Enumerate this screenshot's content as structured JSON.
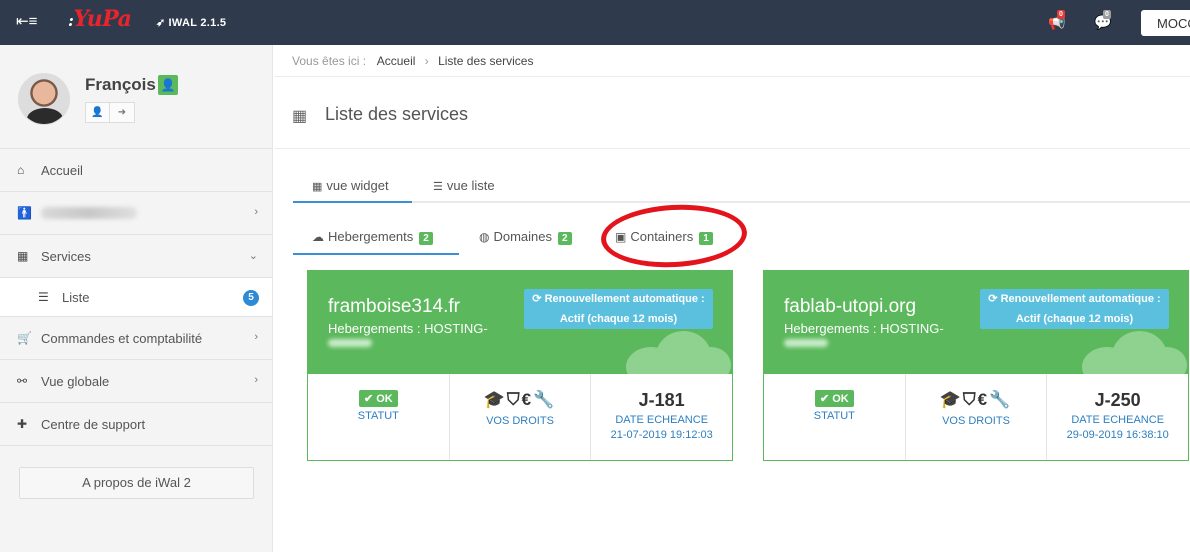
{
  "topbar": {
    "menu_icon": "≡",
    "logo_prefix": ":",
    "logo_text": "YuPa",
    "version": "IWAL 2.1.5",
    "notifications_count": "0",
    "messages_count": "0",
    "user_button": "MOCC"
  },
  "profile": {
    "name": "François"
  },
  "sidebar": {
    "items": [
      {
        "label": "Accueil",
        "icon": "home-icon"
      },
      {
        "label": "",
        "icon": "male-icon"
      },
      {
        "label": "Services",
        "icon": "cubes-icon"
      },
      {
        "label": "Commandes et comptabilité",
        "icon": "cart-icon"
      },
      {
        "label": "Vue globale",
        "icon": "binoculars-icon"
      },
      {
        "label": "Centre de support",
        "icon": "medkit-icon"
      }
    ],
    "sub_item": {
      "label": "Liste",
      "count": "5"
    },
    "about_label": "A propos de iWal 2"
  },
  "breadcrumb": {
    "prefix": "Vous êtes ici :",
    "home": "Accueil",
    "current": "Liste des services"
  },
  "page": {
    "title": "Liste des services"
  },
  "view_tabs": {
    "widget": "vue widget",
    "list": "vue liste"
  },
  "service_tabs": [
    {
      "label": "Hebergements",
      "count": "2"
    },
    {
      "label": "Domaines",
      "count": "2"
    },
    {
      "label": "Containers",
      "count": "1"
    }
  ],
  "cards": [
    {
      "name": "framboise314.fr",
      "plan": "Hebergements : HOSTING-",
      "renew_line1": "Renouvellement automatique :",
      "renew_line2": "Actif (chaque 12 mois)",
      "status": "OK",
      "status_caption": "STATUT",
      "rights_icons": "🎓⛉€🔧",
      "rights_caption": "VOS DROITS",
      "days": "J-181",
      "due_caption": "DATE ECHEANCE",
      "due_date": "21-07-2019 19:12:03"
    },
    {
      "name": "fablab-utopi.org",
      "plan": "Hebergements : HOSTING-",
      "renew_line1": "Renouvellement automatique :",
      "renew_line2": "Actif (chaque 12 mois)",
      "status": "OK",
      "status_caption": "STATUT",
      "rights_icons": "🎓⛉€🔧",
      "rights_caption": "VOS DROITS",
      "days": "J-250",
      "due_caption": "DATE ECHEANCE",
      "due_date": "29-09-2019 16:38:10"
    }
  ],
  "colors": {
    "navbar": "#2f3a4c",
    "success": "#5cb85c",
    "info": "#5bc0de",
    "link": "#2d7fc0",
    "accent": "#3a8fd6",
    "annotation": "#e3141c"
  }
}
